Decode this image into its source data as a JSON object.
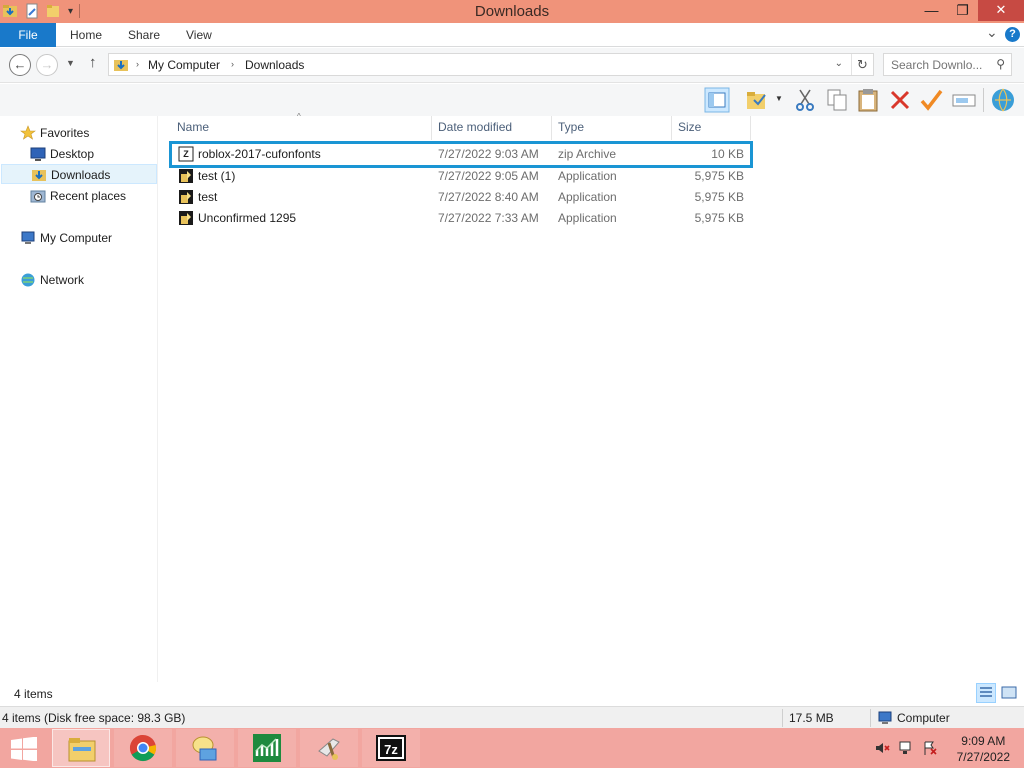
{
  "window": {
    "title": "Downloads",
    "minimize_glyph": "—",
    "maximize_glyph": "❐",
    "close_glyph": "✕"
  },
  "ribbon": {
    "tabs": [
      "File",
      "Home",
      "Share",
      "View"
    ],
    "expand_glyph": "⌄",
    "help_glyph": "?"
  },
  "address": {
    "crumbs": [
      "My Computer",
      "Downloads"
    ],
    "separator": "›",
    "search_placeholder": "Search Downlo..."
  },
  "nav_pane": {
    "favorites_label": "Favorites",
    "items": [
      "Desktop",
      "Downloads",
      "Recent places"
    ],
    "computer_label": "My Computer",
    "network_label": "Network"
  },
  "file_list": {
    "columns": [
      "Name",
      "Date modified",
      "Type",
      "Size"
    ],
    "files": [
      {
        "name": "roblox-2017-cufonfonts",
        "date": "7/27/2022 9:03 AM",
        "type": "zip Archive",
        "size": "10 KB",
        "icon": "zip-archive-icon"
      },
      {
        "name": "test (1)",
        "date": "7/27/2022 9:05 AM",
        "type": "Application",
        "size": "5,975 KB",
        "icon": "application-icon"
      },
      {
        "name": "test",
        "date": "7/27/2022 8:40 AM",
        "type": "Application",
        "size": "5,975 KB",
        "icon": "application-icon"
      },
      {
        "name": "Unconfirmed 1295",
        "date": "7/27/2022 7:33 AM",
        "type": "Application",
        "size": "5,975 KB",
        "icon": "application-icon"
      }
    ]
  },
  "status": {
    "item_count": "4 items"
  },
  "details": {
    "summary": "4 items (Disk free space: 98.3 GB)",
    "size": "17.5 MB",
    "location": "Computer"
  },
  "taskbar": {
    "time": "9:09 AM",
    "date": "7/27/2022",
    "apps": [
      "start-button",
      "file-explorer",
      "chrome",
      "messenger",
      "stock-chart",
      "cleaner",
      "7zip"
    ]
  },
  "colors": {
    "title_bar": "#f0937a",
    "taskbar": "#f2a6a0",
    "accent": "#1979ca",
    "highlight_box": "#1a95d4"
  }
}
